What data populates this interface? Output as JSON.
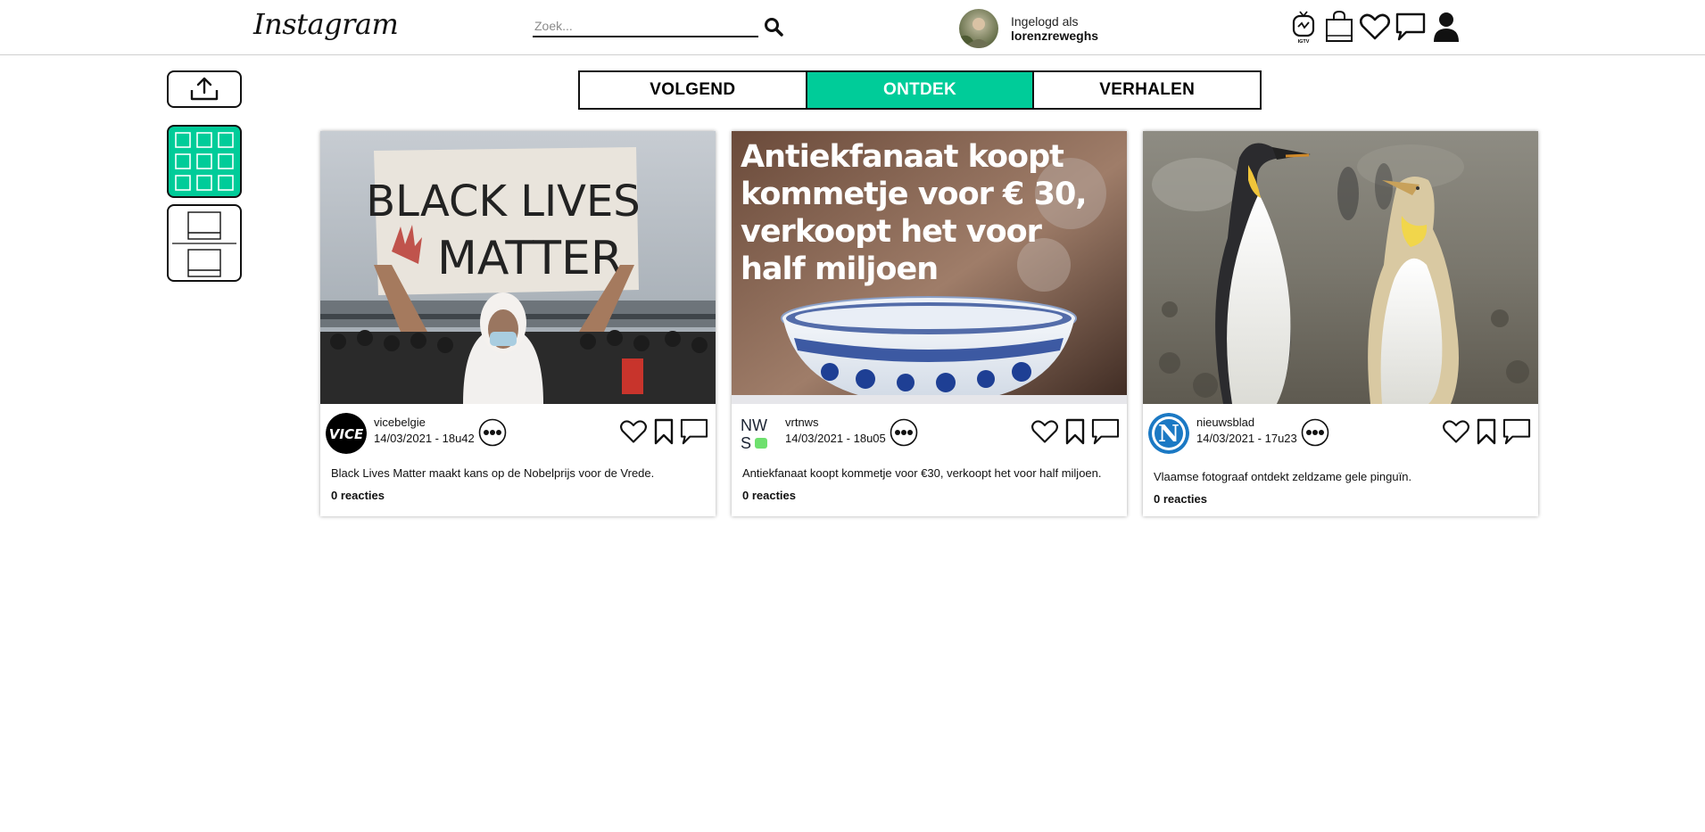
{
  "header": {
    "logo": "Instagram",
    "search_placeholder": "Zoek...",
    "logged_in_label": "Ingelogd als",
    "username": "lorenzreweghs",
    "igtv_label": "IGTV"
  },
  "tabs": [
    {
      "label": "VOLGEND",
      "active": false
    },
    {
      "label": "ONTDEK",
      "active": true
    },
    {
      "label": "VERHALEN",
      "active": false
    }
  ],
  "colors": {
    "accent": "#00cc99",
    "border": "#111111"
  },
  "posts": [
    {
      "source": "vicebelgie",
      "datetime": "14/03/2021 - 18u42",
      "caption": "Black Lives Matter maakt kans op de Nobelprijs voor de Vrede.",
      "reactions": "0 reacties",
      "image_sign_line1": "BLACK LIVES",
      "image_sign_line2": "MATTER",
      "avatar_text": "VICE"
    },
    {
      "source": "vrtnws",
      "datetime": "14/03/2021 - 18u05",
      "caption": "Antiekfanaat koopt kommetje voor €30, verkoopt het voor half miljoen.",
      "reactions": "0 reacties",
      "image_headline": [
        "Antiekfanaat koopt",
        "kommetje voor € 30,",
        "verkoopt het voor",
        "half miljoen"
      ],
      "avatar_text_1": "NW",
      "avatar_text_2": "S"
    },
    {
      "source": "nieuwsblad",
      "datetime": "14/03/2021 - 17u23",
      "caption": "Vlaamse fotograaf ontdekt zeldzame gele pinguïn.",
      "reactions": "0 reacties",
      "avatar_text": "N"
    }
  ]
}
